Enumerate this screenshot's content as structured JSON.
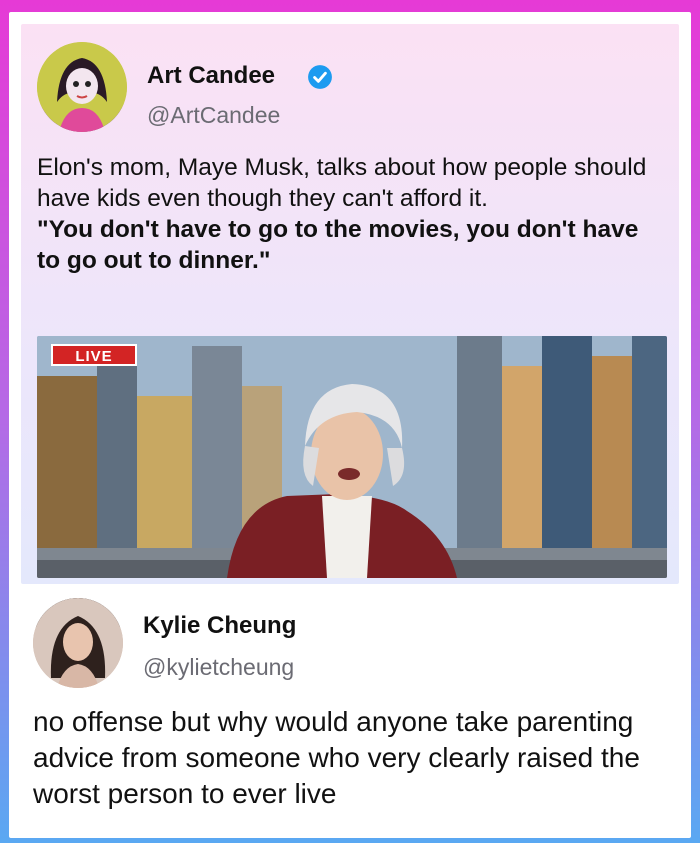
{
  "tweet1": {
    "author_name": "Art Candee",
    "author_handle": "@ArtCandee",
    "text_plain": "Elon's mom, Maye Musk, talks about how people should have kids even though they can't afford it.",
    "text_bold": "\"You don't have to go to the movies, you don't have to go out to dinner.\"",
    "media": {
      "badge": "LIVE"
    }
  },
  "tweet2": {
    "author_name": "Kylie Cheung",
    "author_handle": "@kylietcheung",
    "text": "no offense but why would anyone take parenting advice from someone who very clearly raised the worst person to ever live"
  },
  "colors": {
    "verified": "#1d9bf0",
    "live_badge": "#d32424",
    "frame_gradient_top": "#e63ad6",
    "frame_gradient_bottom": "#5aa8f2"
  }
}
